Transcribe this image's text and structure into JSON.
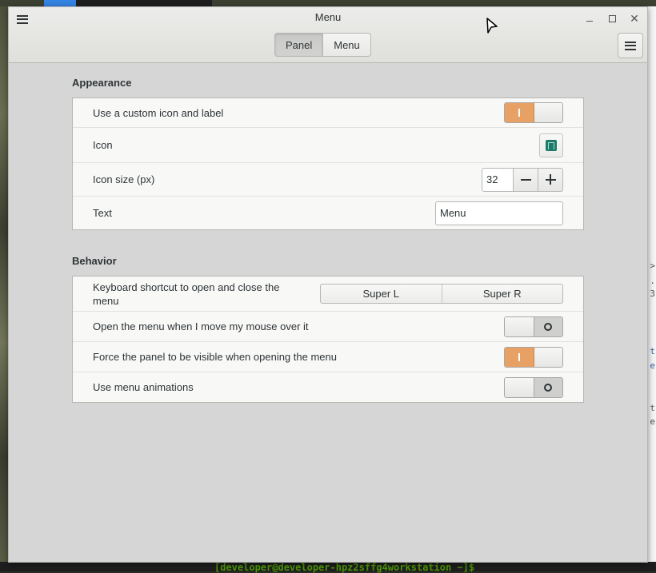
{
  "window": {
    "title": "Menu"
  },
  "headerbar": {
    "stack_tabs": [
      {
        "label": "Panel",
        "active": true
      },
      {
        "label": "Menu",
        "active": false
      }
    ],
    "menu_icon": "hamburger-icon"
  },
  "appearance": {
    "title": "Appearance",
    "custom_icon_label": "Use a custom icon and label",
    "custom_icon_enabled": true,
    "icon_label": "Icon",
    "icon_size_label": "Icon size (px)",
    "icon_size_value": "32",
    "text_label": "Text",
    "text_value": "Menu"
  },
  "behavior": {
    "title": "Behavior",
    "shortcut_label": "Keyboard shortcut to open and close the menu",
    "shortcut_options": [
      "Super L",
      "Super R"
    ],
    "hover_label": "Open the menu when I move my mouse over it",
    "hover_enabled": false,
    "force_panel_label": "Force the panel to be visible when opening the menu",
    "force_panel_enabled": true,
    "animations_label": "Use menu animations",
    "animations_enabled": false
  },
  "terminal": {
    "prompt": "[developer@developer-hpz2sffg4workstation ~]$ "
  },
  "colors": {
    "accent": "#e8a165",
    "background": "#d6d6d6",
    "listbox": "#f8f8f7"
  }
}
